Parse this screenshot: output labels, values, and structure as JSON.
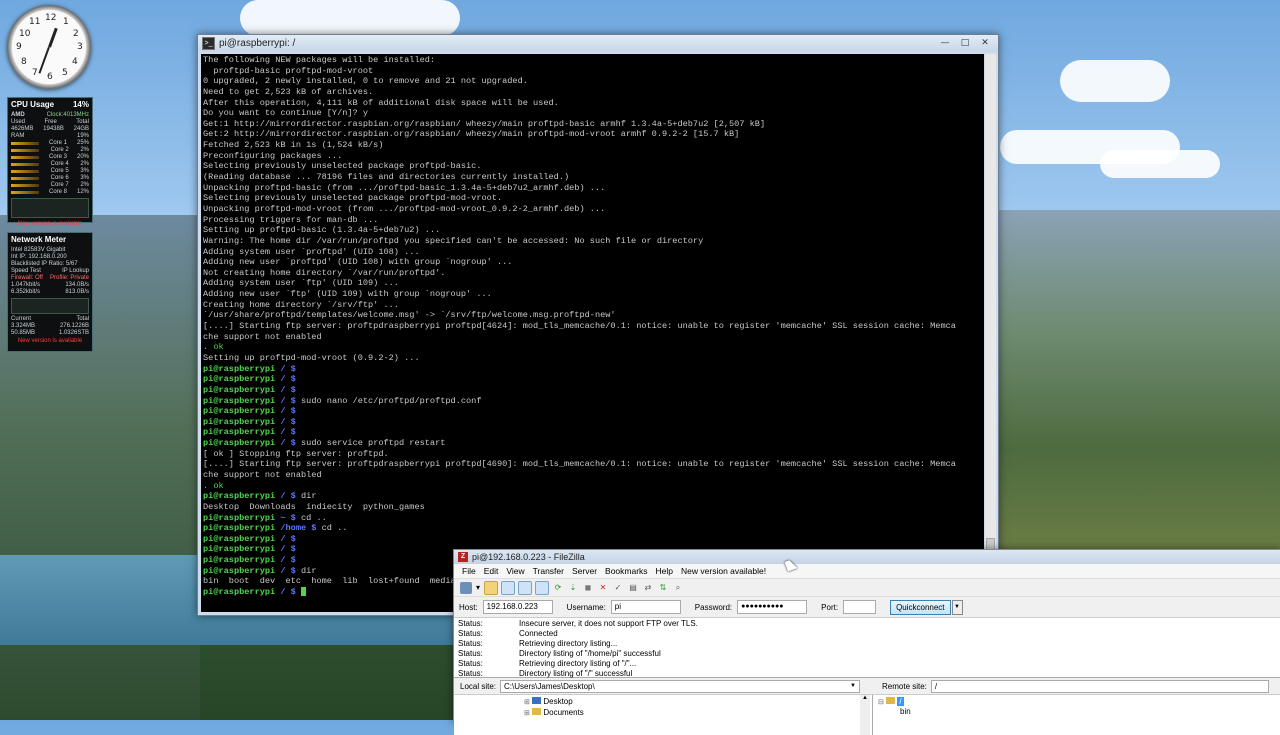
{
  "desktop": {
    "clock": {
      "numbers": [
        "12",
        "1",
        "2",
        "3",
        "4",
        "5",
        "6",
        "7",
        "8",
        "9",
        "10",
        "11"
      ]
    },
    "cpu_gadget": {
      "title": "CPU Usage",
      "percent": "14%",
      "vendor": "AMD",
      "clock": "Clock:4013MHz",
      "mem_header": [
        "Used",
        "Free",
        "Total"
      ],
      "mem_values": [
        "4626MB",
        "19438B",
        "24GB"
      ],
      "ram_label": "RAM",
      "ram_percent": "19%",
      "cores": [
        {
          "label": "Core 1",
          "value": "25%"
        },
        {
          "label": "Core 2",
          "value": "2%"
        },
        {
          "label": "Core 3",
          "value": "20%"
        },
        {
          "label": "Core 4",
          "value": "2%"
        },
        {
          "label": "Core 5",
          "value": "3%"
        },
        {
          "label": "Core 6",
          "value": "3%"
        },
        {
          "label": "Core 7",
          "value": "2%"
        },
        {
          "label": "Core 8",
          "value": "12%"
        }
      ],
      "new_version": "New version is available"
    },
    "net_gadget": {
      "title": "Network Meter",
      "adapter": "Intel 82583V Gigabit",
      "int_ip": "Int IP: 192.168.0.200",
      "blacklist": "Blacklisted IP Ratio: 5/67",
      "speed_test": "Speed Test",
      "ip_lookup": "IP Lookup",
      "firewall": "Firewall: Off",
      "profile": "Profile: Private",
      "up_rate": "1.047kbit/s",
      "up_total": "134.0B/s",
      "down_rate": "6.352kbit/s",
      "down_total": "813.0B/s",
      "current_label": "Current",
      "total_label": "Total",
      "cur_up": "3.324MB",
      "cur_down": "50.85MB",
      "tot_up": "276.1226B",
      "tot_down": "1.0326STB",
      "new_version": "New version is available"
    }
  },
  "terminal": {
    "title": "pi@raspberrypi: /",
    "window_buttons": [
      "—",
      "□",
      "✕"
    ],
    "lines": [
      {
        "t": "The following NEW packages will be installed:"
      },
      {
        "t": "  proftpd-basic proftpd-mod-vroot"
      },
      {
        "t": "0 upgraded, 2 newly installed, 0 to remove and 21 not upgraded."
      },
      {
        "t": "Need to get 2,523 kB of archives."
      },
      {
        "t": "After this operation, 4,111 kB of additional disk space will be used."
      },
      {
        "t": "Do you want to continue [Y/n]? y"
      },
      {
        "t": "Get:1 http://mirrordirector.raspbian.org/raspbian/ wheezy/main proftpd-basic armhf 1.3.4a-5+deb7u2 [2,507 kB]"
      },
      {
        "t": "Get:2 http://mirrordirector.raspbian.org/raspbian/ wheezy/main proftpd-mod-vroot armhf 0.9.2-2 [15.7 kB]"
      },
      {
        "t": "Fetched 2,523 kB in 1s (1,524 kB/s)"
      },
      {
        "t": "Preconfiguring packages ..."
      },
      {
        "t": "Selecting previously unselected package proftpd-basic."
      },
      {
        "t": "(Reading database ... 78196 files and directories currently installed.)"
      },
      {
        "t": "Unpacking proftpd-basic (from .../proftpd-basic_1.3.4a-5+deb7u2_armhf.deb) ..."
      },
      {
        "t": "Selecting previously unselected package proftpd-mod-vroot."
      },
      {
        "t": "Unpacking proftpd-mod-vroot (from .../proftpd-mod-vroot_0.9.2-2_armhf.deb) ..."
      },
      {
        "t": "Processing triggers for man-db ..."
      },
      {
        "t": "Setting up proftpd-basic (1.3.4a-5+deb7u2) ..."
      },
      {
        "t": "Warning: The home dir /var/run/proftpd you specified can't be accessed: No such file or directory"
      },
      {
        "t": "Adding system user `proftpd' (UID 108) ..."
      },
      {
        "t": "Adding new user `proftpd' (UID 108) with group `nogroup' ..."
      },
      {
        "t": "Not creating home directory `/var/run/proftpd'."
      },
      {
        "t": "Adding system user `ftp' (UID 109) ..."
      },
      {
        "t": "Adding new user `ftp' (UID 109) with group `nogroup' ..."
      },
      {
        "t": "Creating home directory `/srv/ftp' ..."
      },
      {
        "t": "`/usr/share/proftpd/templates/welcome.msg' -> `/srv/ftp/welcome.msg.proftpd-new'"
      },
      {
        "t": "[....] Starting ftp server: proftpdraspberrypi proftpd[4624]: mod_tls_memcache/0.1: notice: unable to register 'memcache' SSL session cache: Memca"
      },
      {
        "t": "che support not enabled"
      },
      {
        "t": ". ok"
      },
      {
        "t": "Setting up proftpd-mod-vroot (0.9.2-2) ..."
      },
      {
        "p": "pi@raspberrypi",
        "path": " / $",
        "t": ""
      },
      {
        "p": "pi@raspberrypi",
        "path": " / $",
        "t": ""
      },
      {
        "p": "pi@raspberrypi",
        "path": " / $",
        "t": ""
      },
      {
        "p": "pi@raspberrypi",
        "path": " / $",
        "t": " sudo nano /etc/proftpd/proftpd.conf"
      },
      {
        "p": "pi@raspberrypi",
        "path": " / $",
        "t": ""
      },
      {
        "p": "pi@raspberrypi",
        "path": " / $",
        "t": ""
      },
      {
        "p": "pi@raspberrypi",
        "path": " / $",
        "t": ""
      },
      {
        "p": "pi@raspberrypi",
        "path": " / $",
        "t": " sudo service proftpd restart"
      },
      {
        "t": "[ ok ] Stopping ftp server: proftpd."
      },
      {
        "t": "[....] Starting ftp server: proftpdraspberrypi proftpd[4690]: mod_tls_memcache/0.1: notice: unable to register 'memcache' SSL session cache: Memca"
      },
      {
        "t": "che support not enabled"
      },
      {
        "t": ". ok"
      },
      {
        "p": "pi@raspberrypi",
        "path": " / $",
        "t": " dir"
      },
      {
        "t": "Desktop  Downloads  indiecity  python_games"
      },
      {
        "p": "pi@raspberrypi",
        "path": " ~ $",
        "t": " cd .."
      },
      {
        "p": "pi@raspberrypi",
        "path": " /home $",
        "t": " cd .."
      },
      {
        "p": "pi@raspberrypi",
        "path": " / $",
        "t": ""
      },
      {
        "p": "pi@raspberrypi",
        "path": " / $",
        "t": ""
      },
      {
        "p": "pi@raspberrypi",
        "path": " / $",
        "t": ""
      },
      {
        "p": "pi@raspberrypi",
        "path": " / $",
        "t": " dir"
      },
      {
        "t": "bin  boot  dev  etc  home  lib  lost+found  media  mnt  opt  proc  root  run  sbin  selinux  srv  sys  tmp  usr  var"
      },
      {
        "p": "pi@raspberrypi",
        "path": " / $",
        "t": " ",
        "cursor": true
      }
    ]
  },
  "filezilla": {
    "title": "pi@192.168.0.223 - FileZilla",
    "menu": [
      "File",
      "Edit",
      "View",
      "Transfer",
      "Server",
      "Bookmarks",
      "Help",
      "New version available!"
    ],
    "host_label": "Host:",
    "host_value": "192.168.0.223",
    "username_label": "Username:",
    "username_value": "pi",
    "password_label": "Password:",
    "password_value": "●●●●●●●●●●",
    "port_label": "Port:",
    "port_value": "",
    "quickconnect": "Quickconnect",
    "log": [
      {
        "k": "Status:",
        "v": "Insecure server, it does not support FTP over TLS."
      },
      {
        "k": "Status:",
        "v": "Connected"
      },
      {
        "k": "Status:",
        "v": "Retrieving directory listing..."
      },
      {
        "k": "Status:",
        "v": "Directory listing of \"/home/pi\" successful"
      },
      {
        "k": "Status:",
        "v": "Retrieving directory listing of \"/\"..."
      },
      {
        "k": "Status:",
        "v": "Directory listing of \"/\" successful"
      }
    ],
    "local_label": "Local site:",
    "local_value": "C:\\Users\\James\\Desktop\\",
    "remote_label": "Remote site:",
    "remote_value": "/",
    "local_tree": [
      "Desktop",
      "Documents"
    ],
    "remote_tree": [
      "/",
      "bin"
    ]
  }
}
